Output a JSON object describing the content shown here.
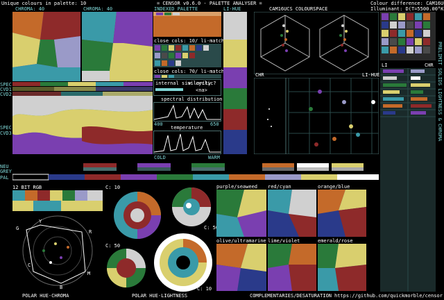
{
  "header": {
    "unique_colours": "Unique colours in palette: 10",
    "title": "= CENSOR v0.6.0 - PALETTE ANALYSER =",
    "colour_difference": "Colour difference: CAM16UCS",
    "illuminant": "Illuminant: D(T=5500.00°K)"
  },
  "panels": {
    "chroma_left": "CHROMA: 40",
    "chroma_right": "CHROMA: 40",
    "indexed_palette": "INDEXED PALETTE",
    "li_hue_top": "LI-HUE",
    "cam16ucs": "CAM16UCS COLOURSPACE",
    "li": "LI",
    "chr": "CHR",
    "chr_small": "CHR",
    "li_hue": "LI-HUE",
    "close_cols_1": "close cols: 10/ li-match",
    "close_cols_2": "close cols: 70/ li-match",
    "internal_similarity": "internal similarity",
    "cyclic": "cyclic?",
    "na": "<na>",
    "spectral": "spectral distribution",
    "spectral_min": "400",
    "spectral_max": "650",
    "temperature": "temperature",
    "cold": "COLD",
    "warm": "WARM",
    "bit12": "12 BIT RGB",
    "c10_a": "C: 10",
    "c50_a": "C: 50",
    "c50_b": "C: 50",
    "c10_b": "C: 10",
    "neu": "NEU",
    "grey": "GREY",
    "pal": "PAL",
    "polar_hue_chroma": "POLAR HUE-CHROMA",
    "polar_hue_lightness": "POLAR HUE-LIGHTNESS",
    "complementaries": "COMPLEMENTARIES/DESATURATION",
    "github": "https://github.com/quickmorble/censor",
    "side_label": "PRELIMIT SOLIDS LIGHTNESS & CHROMA",
    "hue_letters": [
      "G",
      "Y",
      "R",
      "M",
      "B",
      "C"
    ],
    "comp_labels": [
      "purple/seaweed",
      "red/cyan",
      "orange/blue",
      "olive/ultramarine",
      "lime/violet",
      "emerald/rose"
    ],
    "side_labels": [
      "SPEC",
      "CVD1",
      "CVD2",
      "SPEC",
      "CVD3"
    ]
  },
  "palette": [
    "#7a3fb0",
    "#2a7a3a",
    "#d9cf6e",
    "#8e2a2a",
    "#3a9aa8",
    "#c46a2a",
    "#2a3a8a",
    "#d0d0d0",
    "#9a9ac8",
    "#4a4a4a"
  ]
}
